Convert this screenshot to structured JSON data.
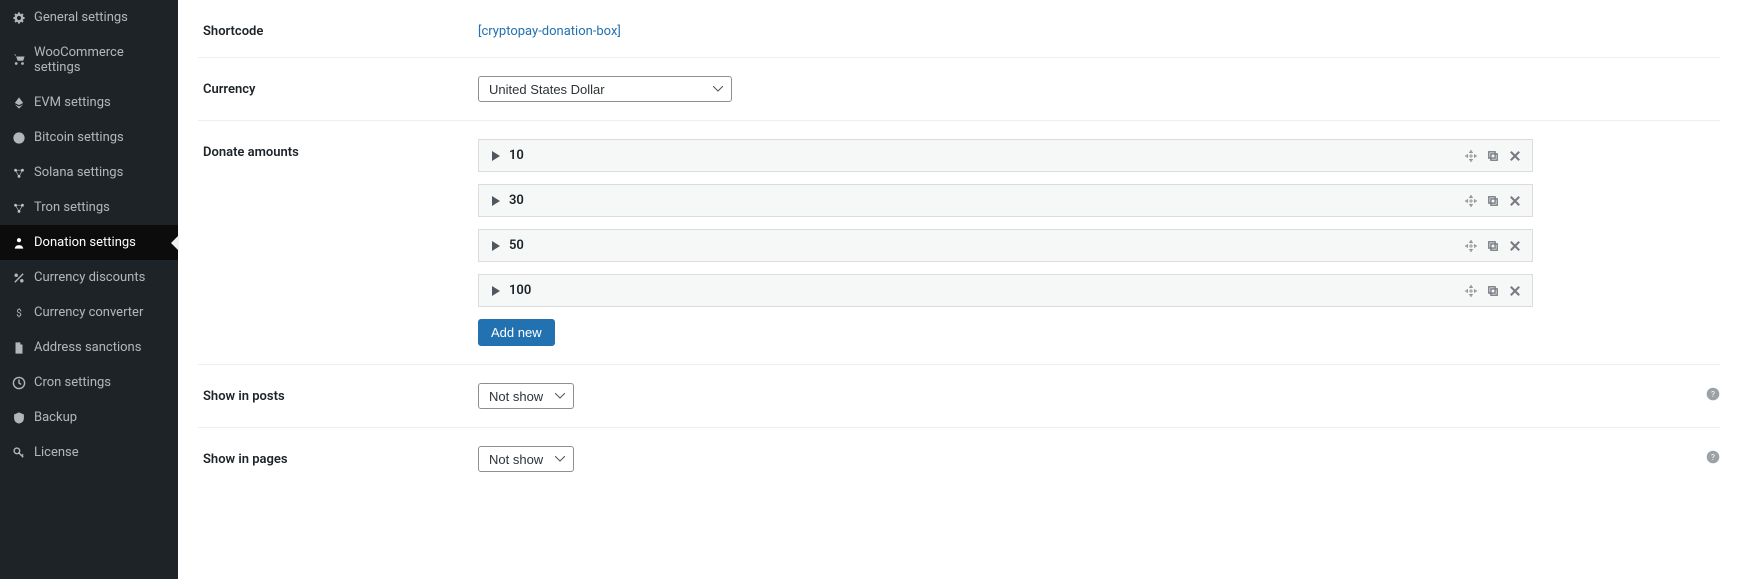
{
  "sidebar": {
    "items": [
      {
        "label": "General settings"
      },
      {
        "label": "WooCommerce settings"
      },
      {
        "label": "EVM settings"
      },
      {
        "label": "Bitcoin settings"
      },
      {
        "label": "Solana settings"
      },
      {
        "label": "Tron settings"
      },
      {
        "label": "Donation settings"
      },
      {
        "label": "Currency discounts"
      },
      {
        "label": "Currency converter"
      },
      {
        "label": "Address sanctions"
      },
      {
        "label": "Cron settings"
      },
      {
        "label": "Backup"
      },
      {
        "label": "License"
      }
    ]
  },
  "main": {
    "shortcode": {
      "label": "Shortcode",
      "value": "[cryptopay-donation-box]"
    },
    "currency": {
      "label": "Currency",
      "selected": "United States Dollar"
    },
    "donate_amounts": {
      "label": "Donate amounts",
      "values": [
        "10",
        "30",
        "50",
        "100"
      ],
      "add_new_label": "Add new"
    },
    "show_in_posts": {
      "label": "Show in posts",
      "selected": "Not show"
    },
    "show_in_pages": {
      "label": "Show in pages",
      "selected": "Not show"
    }
  }
}
